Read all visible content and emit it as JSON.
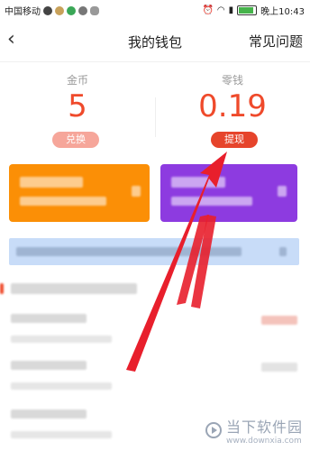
{
  "status_bar": {
    "carrier": "中国移动",
    "time_label": "晚上10:43"
  },
  "nav": {
    "title": "我的钱包",
    "faq_label": "常见问题"
  },
  "wallet": {
    "coins_label": "金币",
    "coins_value": "5",
    "exchange_label": "兑换",
    "change_label": "零钱",
    "change_value": "0.19",
    "withdraw_label": "提现"
  },
  "colors": {
    "accent_red": "#ef4a2b",
    "card_orange": "#fb8f06",
    "card_purple": "#8d3be0",
    "banner_blue": "#c8dcf8"
  },
  "watermark": {
    "brand": "当下软件园",
    "site": "www.downxia.com"
  }
}
